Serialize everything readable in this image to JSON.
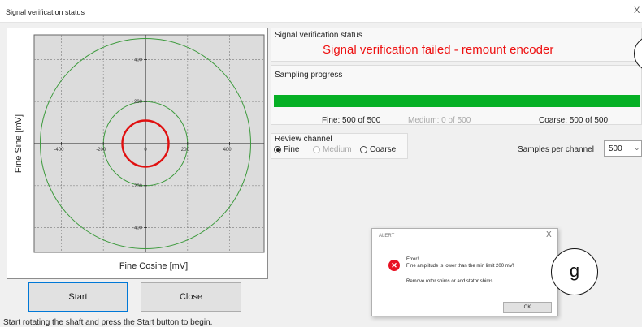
{
  "window": {
    "title": "Signal verification status",
    "close_glyph": "X"
  },
  "chart_data": {
    "type": "scatter",
    "xlabel": "Fine Cosine [mV]",
    "ylabel": "Fine Sine [mV]",
    "xlim": [
      -530,
      530
    ],
    "ylim": [
      -530,
      530
    ],
    "xticks": [
      -400,
      -200,
      0,
      200,
      400
    ],
    "yticks": [
      400,
      200,
      -200,
      -400
    ],
    "x_tick_labels": [
      "-400",
      "-200",
      "0",
      "200",
      "400"
    ],
    "y_tick_labels": [
      "400",
      "200",
      "-200",
      "-400"
    ],
    "grid": true,
    "reference_circles": [
      {
        "name": "",
        "radius_mv": 200,
        "color": "#3c9a3c"
      },
      {
        "name": "",
        "radius_mv": 500,
        "color": "#3c9a3c"
      }
    ],
    "series": [
      {
        "name": "",
        "type": "circle",
        "radius_mv": 110,
        "color": "#e01010"
      }
    ]
  },
  "status": {
    "group_label": "Signal verification status",
    "message": "Signal verification failed - remount encoder",
    "message_color": "#ee1111"
  },
  "sampling": {
    "group_label": "Sampling progress",
    "progress_fraction": 1.0,
    "bar_color": "#06b025",
    "fine": "Fine: 500 of 500",
    "medium": "Medium: 0 of 500",
    "coarse": "Coarse: 500 of 500"
  },
  "review": {
    "group_label": "Review channel",
    "options": [
      {
        "label": "Fine",
        "checked": true,
        "enabled": true
      },
      {
        "label": "Medium",
        "checked": false,
        "enabled": false
      },
      {
        "label": "Coarse",
        "checked": false,
        "enabled": true
      }
    ]
  },
  "samples": {
    "label": "Samples per channel",
    "value": "500"
  },
  "buttons": {
    "start": "Start",
    "close": "Close"
  },
  "statusbar": {
    "text": "Start rotating the shaft and press the Start button to begin."
  },
  "alert": {
    "title": "ALERT",
    "close_glyph": "X",
    "heading": "Error!",
    "line1": "Fine amplitude is lower than the min limit 200 mV!",
    "line2": "Remove rotor shims or add stator shims.",
    "ok": "OK",
    "icon": "error-icon"
  },
  "callouts": {
    "g": "g"
  }
}
